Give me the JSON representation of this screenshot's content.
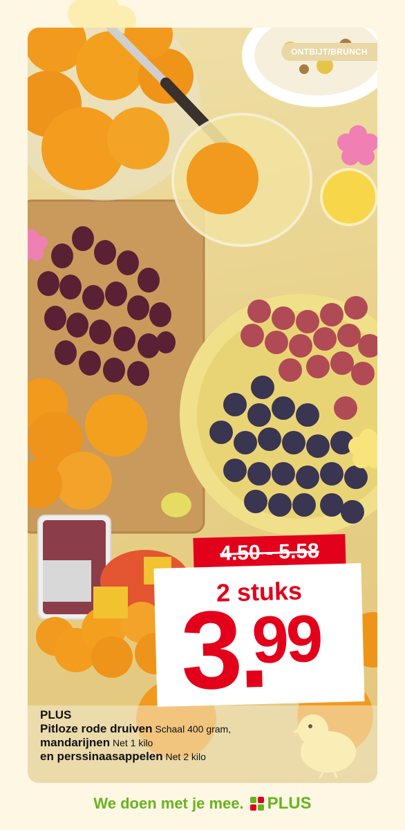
{
  "tag": {
    "label": "ONTBIJT/BRUNCH"
  },
  "price": {
    "old": "4.50 - 5.58",
    "quantity": "2 stuks",
    "main_int": "3.",
    "main_dec": "99"
  },
  "product": {
    "brand": "PLUS",
    "lines": [
      {
        "bold": "Pitloze rode druiven",
        "detail": "Schaal 400 gram,"
      },
      {
        "bold": "mandarijnen",
        "detail": "Net 1 kilo"
      },
      {
        "bold": "en perssinaasappelen",
        "detail": "Net 2 kilo"
      }
    ]
  },
  "footer": {
    "slogan": "We doen met je mee.",
    "logo_text": "PLUS"
  },
  "colors": {
    "accent_red": "#e3001b",
    "brand_green": "#68b31f",
    "background": "#fdf7e4"
  },
  "icons": [
    "flower-icon",
    "chick-icon",
    "plus-logo-icon"
  ]
}
